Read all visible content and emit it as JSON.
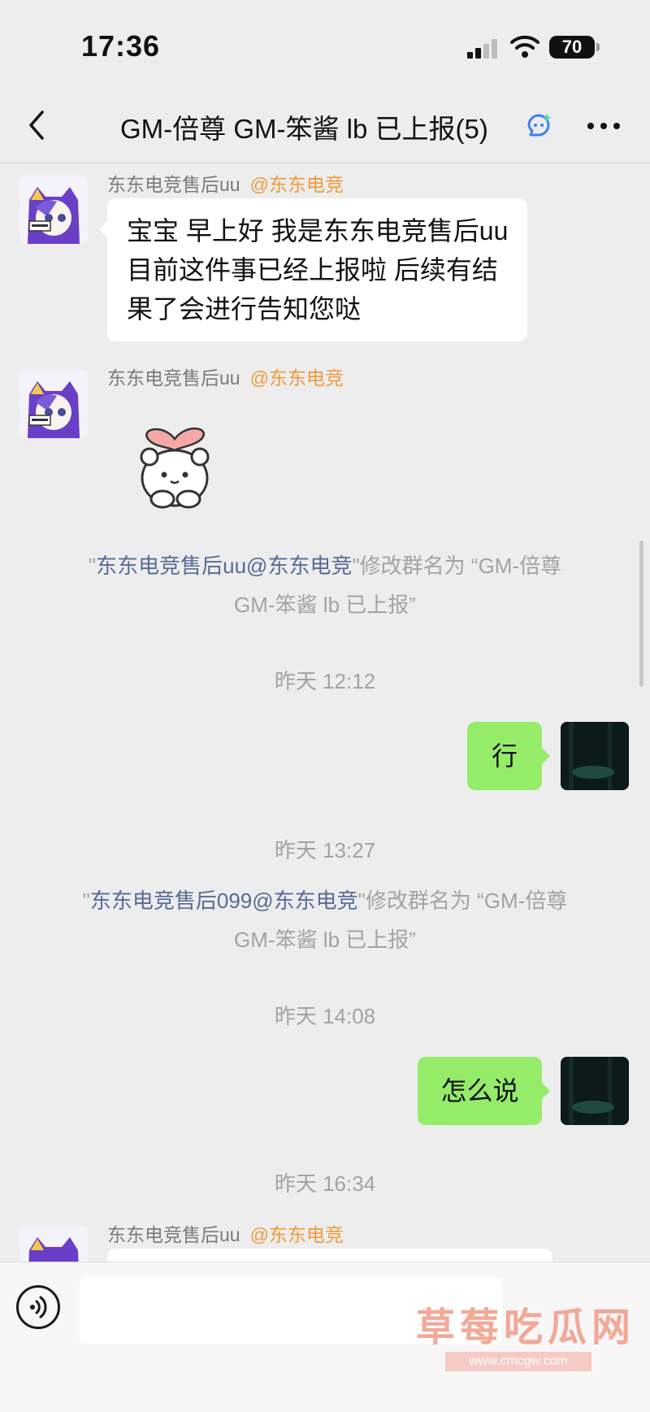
{
  "status_bar": {
    "time": "17:36",
    "battery": "70"
  },
  "nav": {
    "title": "GM-倍尊 GM-笨酱 lb 已上报(5)"
  },
  "messages": [
    {
      "sender": "东东电竞售后uu",
      "tag": "@东东电竞",
      "lines": [
        "宝宝 早上好 我是东东电竞售后uu",
        "目前这件事已经上报啦 后续有结",
        "果了会进行告知您哒"
      ]
    },
    {
      "sender": "东东电竞售后uu",
      "tag": "@东东电竞",
      "sticker": "heart-bear-sticker"
    },
    {
      "type": "system",
      "quote_open": "\"",
      "actor": "东东电竞售后uu@东东电竞",
      "action": "\"修改群名为 “GM-倍尊",
      "line2": "GM-笨酱  lb 已上报”"
    },
    {
      "type": "time",
      "text": "昨天 12:12"
    },
    {
      "type": "outgoing",
      "text": "行"
    },
    {
      "type": "time",
      "text": "昨天 13:27"
    },
    {
      "type": "system",
      "quote_open": "\"",
      "actor": "东东电竞售后099@东东电竞",
      "action": "\"修改群名为 “GM-倍尊",
      "line2": "GM-笨酱  lb 已上报”"
    },
    {
      "type": "time",
      "text": "昨天 14:08"
    },
    {
      "type": "outgoing",
      "text": "怎么说"
    },
    {
      "type": "time",
      "text": "昨天 16:34"
    },
    {
      "sender": "东东电竞售后uu",
      "tag": "@东东电竞"
    }
  ],
  "input_bar": {
    "placeholder": ""
  },
  "watermark": {
    "text": "草莓吃瓜网",
    "url": "www.cmcgw.com"
  },
  "colors": {
    "background": "#ededed",
    "outgoing_bubble": "#95ec69",
    "incoming_bubble": "#ffffff",
    "sender_tag": "#ef9a3a",
    "system_link": "#576b95"
  }
}
